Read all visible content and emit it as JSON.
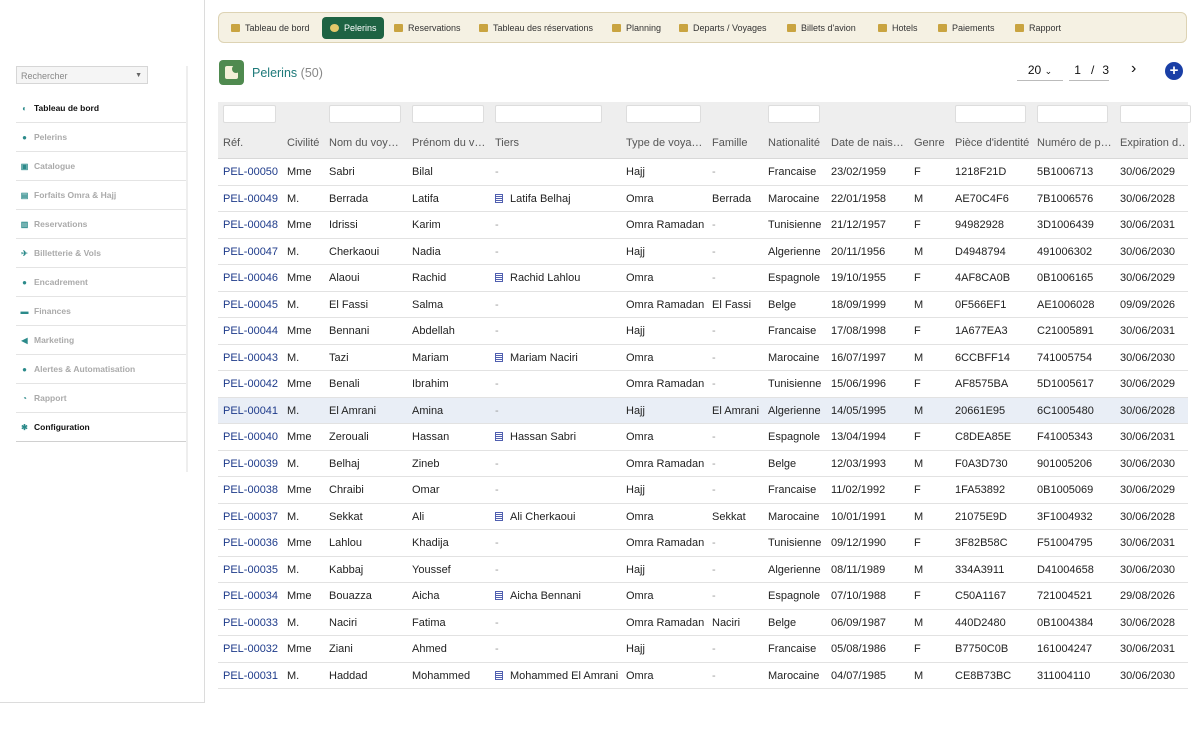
{
  "sidebar": {
    "search_placeholder": "Rechercher",
    "items": [
      {
        "label": "Tableau de bord",
        "icon": "dashboard-icon",
        "dark": true
      },
      {
        "label": "Pelerins",
        "icon": "user-icon",
        "dark": false
      },
      {
        "label": "Catalogue",
        "icon": "catalog-icon",
        "dark": false
      },
      {
        "label": "Forfaits Omra & Hajj",
        "icon": "lock-icon",
        "dark": false
      },
      {
        "label": "Reservations",
        "icon": "clipboard-icon",
        "dark": false
      },
      {
        "label": "Billetterie & Vols",
        "icon": "plane-icon",
        "dark": false
      },
      {
        "label": "Encadrement",
        "icon": "user-icon",
        "dark": false
      },
      {
        "label": "Finances",
        "icon": "money-icon",
        "dark": false
      },
      {
        "label": "Marketing",
        "icon": "megaphone-icon",
        "dark": false
      },
      {
        "label": "Alertes & Automatisation",
        "icon": "users-icon",
        "dark": false
      },
      {
        "label": "Rapport",
        "icon": "chart-icon",
        "dark": false
      },
      {
        "label": "Configuration",
        "icon": "gear-icon",
        "dark": true
      }
    ]
  },
  "topnav": [
    {
      "label": "Tableau de bord",
      "icon": "dashboard-icon",
      "active": false
    },
    {
      "label": "Pelerins",
      "icon": "user-icon",
      "active": true
    },
    {
      "label": "Reservations",
      "icon": "clipboard-icon",
      "active": false
    },
    {
      "label": "Tableau des réservations",
      "icon": "list-icon",
      "active": false
    },
    {
      "label": "Planning",
      "icon": "calendar-icon",
      "active": false
    },
    {
      "label": "Departs / Voyages",
      "icon": "globe-icon",
      "active": false
    },
    {
      "label": "Billets d'avion",
      "icon": "plane-icon",
      "active": false
    },
    {
      "label": "Hotels",
      "icon": "building-icon",
      "active": false
    },
    {
      "label": "Paiements",
      "icon": "money-icon",
      "active": false
    },
    {
      "label": "Rapport",
      "icon": "chart-icon",
      "active": false
    }
  ],
  "page": {
    "title": "Pelerins",
    "count": "(50)"
  },
  "pager": {
    "per_page": "20",
    "page": "1",
    "separator": "/",
    "total": "3"
  },
  "columns": [
    "Réf.",
    "Civilité",
    "Nom du voy…",
    "Prénom du v…",
    "Tiers",
    "Type de voya…",
    "Famille",
    "Nationalité",
    "Date de nais…",
    "Genre",
    "Pièce d'identité",
    "Numéro de p…",
    "Expiration d…"
  ],
  "rows": [
    [
      "PEL-00050",
      "Mme",
      "Sabri",
      "Bilal",
      "-",
      "Hajj",
      "-",
      "Francaise",
      "23/02/1959",
      "F",
      "1218F21D",
      "5B1006713",
      "30/06/2029"
    ],
    [
      "PEL-00049",
      "M.",
      "Berrada",
      "Latifa",
      "Latifa Belhaj",
      "Omra",
      "Berrada",
      "Marocaine",
      "22/01/1958",
      "M",
      "AE70C4F6",
      "7B1006576",
      "30/06/2028"
    ],
    [
      "PEL-00048",
      "Mme",
      "Idrissi",
      "Karim",
      "-",
      "Omra Ramadan",
      "-",
      "Tunisienne",
      "21/12/1957",
      "F",
      "94982928",
      "3D1006439",
      "30/06/2031"
    ],
    [
      "PEL-00047",
      "M.",
      "Cherkaoui",
      "Nadia",
      "-",
      "Hajj",
      "-",
      "Algerienne",
      "20/11/1956",
      "M",
      "D4948794",
      "491006302",
      "30/06/2030"
    ],
    [
      "PEL-00046",
      "Mme",
      "Alaoui",
      "Rachid",
      "Rachid Lahlou",
      "Omra",
      "-",
      "Espagnole",
      "19/10/1955",
      "F",
      "4AF8CA0B",
      "0B1006165",
      "30/06/2029"
    ],
    [
      "PEL-00045",
      "M.",
      "El Fassi",
      "Salma",
      "-",
      "Omra Ramadan",
      "El Fassi",
      "Belge",
      "18/09/1999",
      "M",
      "0F566EF1",
      "AE1006028",
      "09/09/2026"
    ],
    [
      "PEL-00044",
      "Mme",
      "Bennani",
      "Abdellah",
      "-",
      "Hajj",
      "-",
      "Francaise",
      "17/08/1998",
      "F",
      "1A677EA3",
      "C21005891",
      "30/06/2031"
    ],
    [
      "PEL-00043",
      "M.",
      "Tazi",
      "Mariam",
      "Mariam Naciri",
      "Omra",
      "-",
      "Marocaine",
      "16/07/1997",
      "M",
      "6CCBFF14",
      "741005754",
      "30/06/2030"
    ],
    [
      "PEL-00042",
      "Mme",
      "Benali",
      "Ibrahim",
      "-",
      "Omra Ramadan",
      "-",
      "Tunisienne",
      "15/06/1996",
      "F",
      "AF8575BA",
      "5D1005617",
      "30/06/2029"
    ],
    [
      "PEL-00041",
      "M.",
      "El Amrani",
      "Amina",
      "-",
      "Hajj",
      "El Amrani",
      "Algerienne",
      "14/05/1995",
      "M",
      "20661E95",
      "6C1005480",
      "30/06/2028"
    ],
    [
      "PEL-00040",
      "Mme",
      "Zerouali",
      "Hassan",
      "Hassan Sabri",
      "Omra",
      "-",
      "Espagnole",
      "13/04/1994",
      "F",
      "C8DEA85E",
      "F41005343",
      "30/06/2031"
    ],
    [
      "PEL-00039",
      "M.",
      "Belhaj",
      "Zineb",
      "-",
      "Omra Ramadan",
      "-",
      "Belge",
      "12/03/1993",
      "M",
      "F0A3D730",
      "901005206",
      "30/06/2030"
    ],
    [
      "PEL-00038",
      "Mme",
      "Chraibi",
      "Omar",
      "-",
      "Hajj",
      "-",
      "Francaise",
      "11/02/1992",
      "F",
      "1FA53892",
      "0B1005069",
      "30/06/2029"
    ],
    [
      "PEL-00037",
      "M.",
      "Sekkat",
      "Ali",
      "Ali Cherkaoui",
      "Omra",
      "Sekkat",
      "Marocaine",
      "10/01/1991",
      "M",
      "21075E9D",
      "3F1004932",
      "30/06/2028"
    ],
    [
      "PEL-00036",
      "Mme",
      "Lahlou",
      "Khadija",
      "-",
      "Omra Ramadan",
      "-",
      "Tunisienne",
      "09/12/1990",
      "F",
      "3F82B58C",
      "F51004795",
      "30/06/2031"
    ],
    [
      "PEL-00035",
      "M.",
      "Kabbaj",
      "Youssef",
      "-",
      "Hajj",
      "-",
      "Algerienne",
      "08/11/1989",
      "M",
      "334A3911",
      "D41004658",
      "30/06/2030"
    ],
    [
      "PEL-00034",
      "Mme",
      "Bouazza",
      "Aicha",
      "Aicha Bennani",
      "Omra",
      "-",
      "Espagnole",
      "07/10/1988",
      "F",
      "C50A1167",
      "721004521",
      "29/08/2026"
    ],
    [
      "PEL-00033",
      "M.",
      "Naciri",
      "Fatima",
      "-",
      "Omra Ramadan",
      "Naciri",
      "Belge",
      "06/09/1987",
      "M",
      "440D2480",
      "0B1004384",
      "30/06/2028"
    ],
    [
      "PEL-00032",
      "Mme",
      "Ziani",
      "Ahmed",
      "-",
      "Hajj",
      "-",
      "Francaise",
      "05/08/1986",
      "F",
      "B7750C0B",
      "161004247",
      "30/06/2031"
    ],
    [
      "PEL-00031",
      "M.",
      "Haddad",
      "Mohammed",
      "Mohammed El Amrani",
      "Omra",
      "-",
      "Marocaine",
      "04/07/1985",
      "M",
      "CE8B73BC",
      "311004110",
      "30/06/2030"
    ]
  ],
  "highlighted_row": "PEL-00041",
  "colors": {
    "accent": "#1e6343",
    "link": "#1d3a8a",
    "title": "#1e7a7a",
    "add_button": "#1a3fa6"
  }
}
